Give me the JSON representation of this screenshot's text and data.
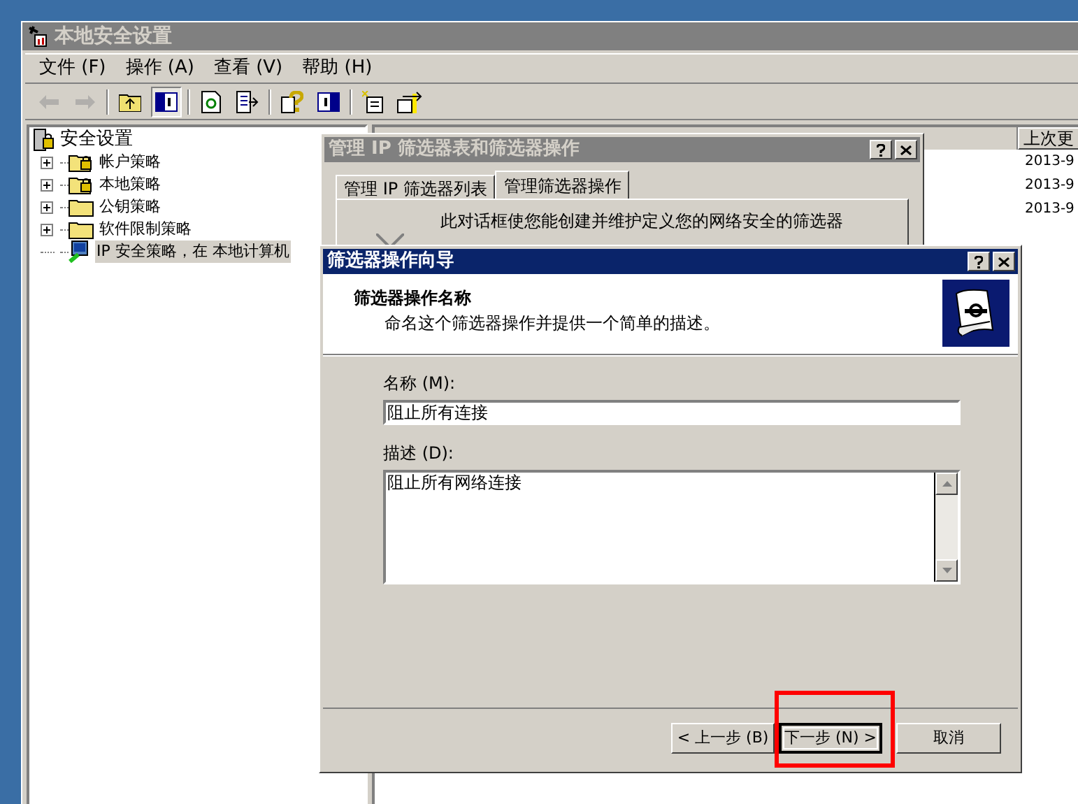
{
  "window": {
    "title": "本地安全设置",
    "active": false
  },
  "menu": [
    "文件 (F)",
    "操作 (A)",
    "查看 (V)",
    "帮助 (H)"
  ],
  "toolbar": [
    {
      "kind": "back",
      "disabled": true
    },
    {
      "kind": "forward",
      "disabled": true
    },
    {
      "kind": "up",
      "disabled": false,
      "pressed": false
    },
    {
      "kind": "tree",
      "disabled": false,
      "pressed": true
    },
    {
      "kind": "refresh",
      "disabled": false,
      "pressed": false
    },
    {
      "kind": "export",
      "disabled": false,
      "pressed": false
    },
    {
      "kind": "help",
      "disabled": false,
      "pressed": false
    },
    {
      "kind": "pane",
      "disabled": false,
      "pressed": false
    },
    {
      "kind": "new",
      "disabled": false,
      "pressed": false
    },
    {
      "kind": "add",
      "disabled": false,
      "pressed": false
    }
  ],
  "tree": {
    "label": "安全设置",
    "children": [
      {
        "label": "帐户策略",
        "kind": "lock",
        "expanded": false,
        "selected": false
      },
      {
        "label": "本地策略",
        "kind": "lock",
        "expanded": false,
        "selected": false
      },
      {
        "label": "公钥策略",
        "kind": "folder",
        "expanded": false,
        "selected": false
      },
      {
        "label": "软件限制策略",
        "kind": "folder",
        "expanded": false,
        "selected": false
      },
      {
        "label": "IP 安全策略，在 本地计算机",
        "kind": "ipsec",
        "selected": true
      }
    ]
  },
  "list": {
    "column_header": "上次更",
    "rows": [
      "2013-9",
      "2013-9",
      "2013-9"
    ]
  },
  "manage_dialog": {
    "title": "管理 IP 筛选器表和筛选器操作",
    "active": false,
    "tabs": [
      {
        "label": "管理 IP 筛选器列表",
        "selected": false
      },
      {
        "label": "管理筛选器操作",
        "selected": true
      }
    ],
    "description": "此对话框使您能创建并维护定义您的网络安全的筛选器"
  },
  "wizard": {
    "title": "筛选器操作向导",
    "active": true,
    "heading": "筛选器操作名称",
    "subheading": "命名这个筛选器操作并提供一个简单的描述。",
    "name_label": "名称 (M):",
    "name_value": "阻止所有连接",
    "description_label": "描述 (D):",
    "description_value": "阻止所有网络连接",
    "buttons": [
      {
        "label": "< 上一步 (B)",
        "default": false,
        "highlighted": false
      },
      {
        "label": "下一步 (N) >",
        "default": true,
        "highlighted": true
      },
      {
        "label": "取消",
        "default": false,
        "highlighted": false
      }
    ]
  }
}
